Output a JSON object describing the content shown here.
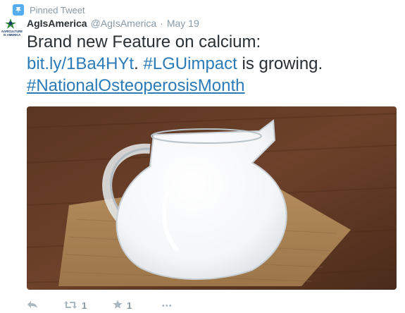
{
  "pinned": {
    "label": "Pinned Tweet",
    "icon": "pin-icon",
    "accent": "#55acee"
  },
  "author": {
    "fullname": "AgIsAmerica",
    "handle": "@AgIsAmerica",
    "separator": "·",
    "date": "May 19",
    "avatar_icon": "agriculture-is-america-logo",
    "avatar_text": "AGRICULTURE IS AMERICA"
  },
  "tweet": {
    "line1": "Brand new Feature on calcium:",
    "link": "bit.ly/1Ba4HYt",
    "period": ".",
    "hashtag1": "#LGUimpact",
    "middle": " is growing.",
    "hashtag2": "#NationalOsteoperosisMonth",
    "link_color": "#2b7bb9"
  },
  "media": {
    "icon": "milk-jug-photo"
  },
  "actions": {
    "reply_icon": "reply-icon",
    "retweet_icon": "retweet-icon",
    "retweet_count": "1",
    "favorite_icon": "favorite-star-icon",
    "favorite_count": "1",
    "more_icon": "more-icon",
    "more_label": "•••"
  }
}
